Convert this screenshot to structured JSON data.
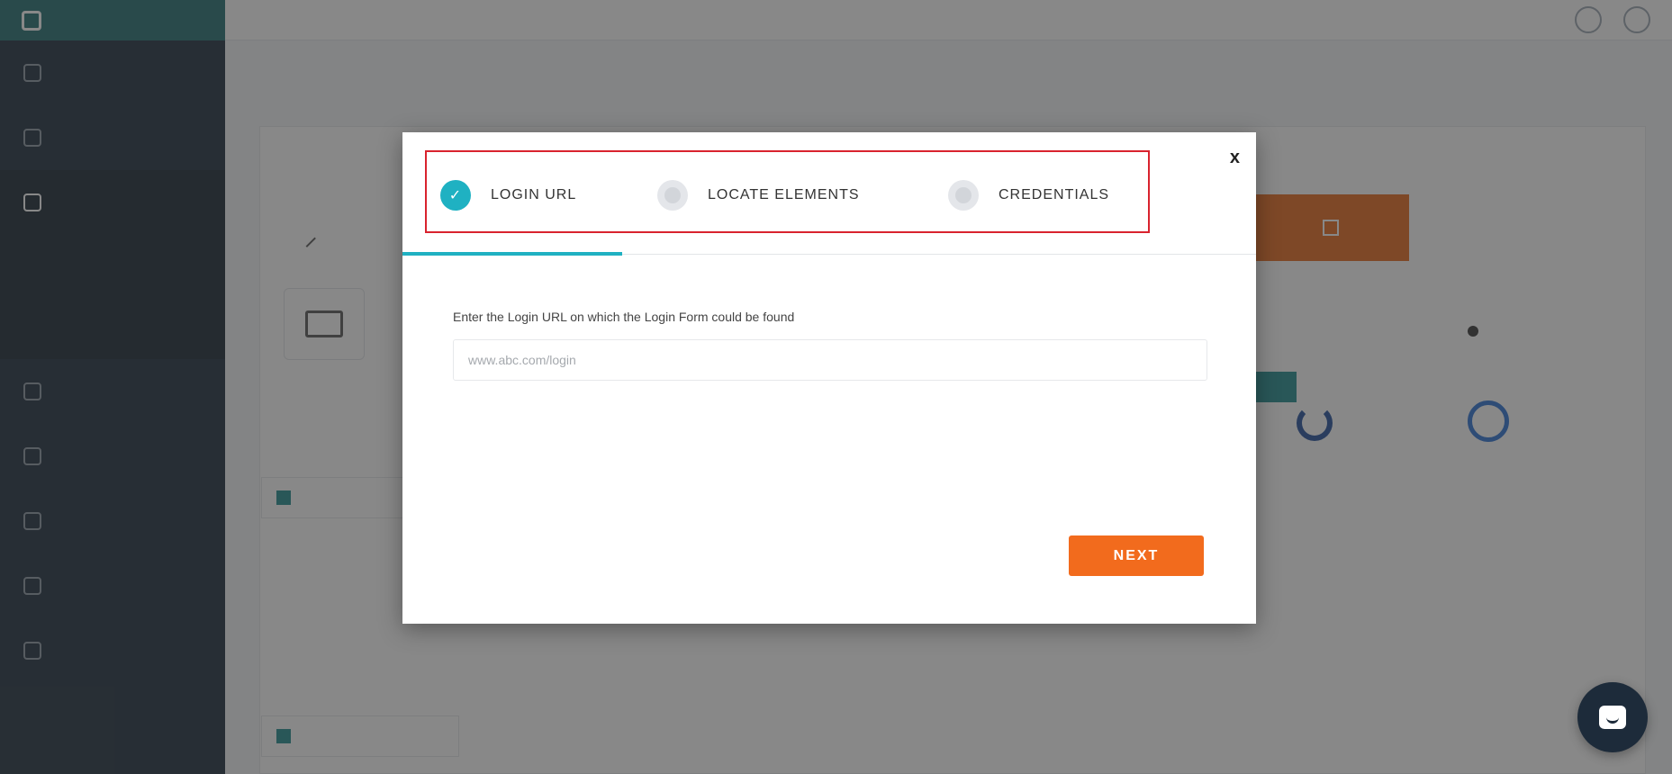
{
  "modal": {
    "steps": [
      {
        "label": "LOGIN URL",
        "state": "completed",
        "icon": "check-icon",
        "glyph": "✓"
      },
      {
        "label": "LOCATE ELEMENTS",
        "state": "pending"
      },
      {
        "label": "CREDENTIALS",
        "state": "pending"
      }
    ],
    "close_glyph": "x",
    "field_label": "Enter the Login URL on which the Login Form could be found",
    "url_placeholder": "www.abc.com/login",
    "url_value": "",
    "next_label": "NEXT"
  },
  "colors": {
    "accent_teal": "#1fb1c2",
    "next_orange": "#f26b1d",
    "highlight_red": "#d9232e"
  }
}
